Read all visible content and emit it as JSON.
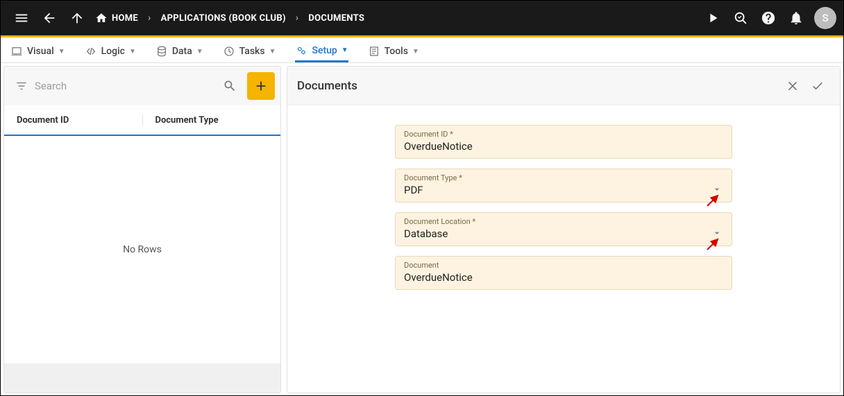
{
  "topbar": {
    "home_label": "HOME",
    "breadcrumb_app": "APPLICATIONS (BOOK CLUB)",
    "breadcrumb_page": "DOCUMENTS",
    "avatar_initial": "S"
  },
  "tabs": {
    "visual": "Visual",
    "logic": "Logic",
    "data": "Data",
    "tasks": "Tasks",
    "setup": "Setup",
    "tools": "Tools"
  },
  "left": {
    "search_placeholder": "Search",
    "col_id": "Document ID",
    "col_type": "Document Type",
    "no_rows": "No Rows"
  },
  "right": {
    "title": "Documents",
    "fields": {
      "doc_id": {
        "label": "Document ID *",
        "value": "OverdueNotice"
      },
      "doc_type": {
        "label": "Document Type *",
        "value": "PDF"
      },
      "doc_location": {
        "label": "Document Location *",
        "value": "Database"
      },
      "document": {
        "label": "Document",
        "value": "OverdueNotice"
      }
    }
  }
}
